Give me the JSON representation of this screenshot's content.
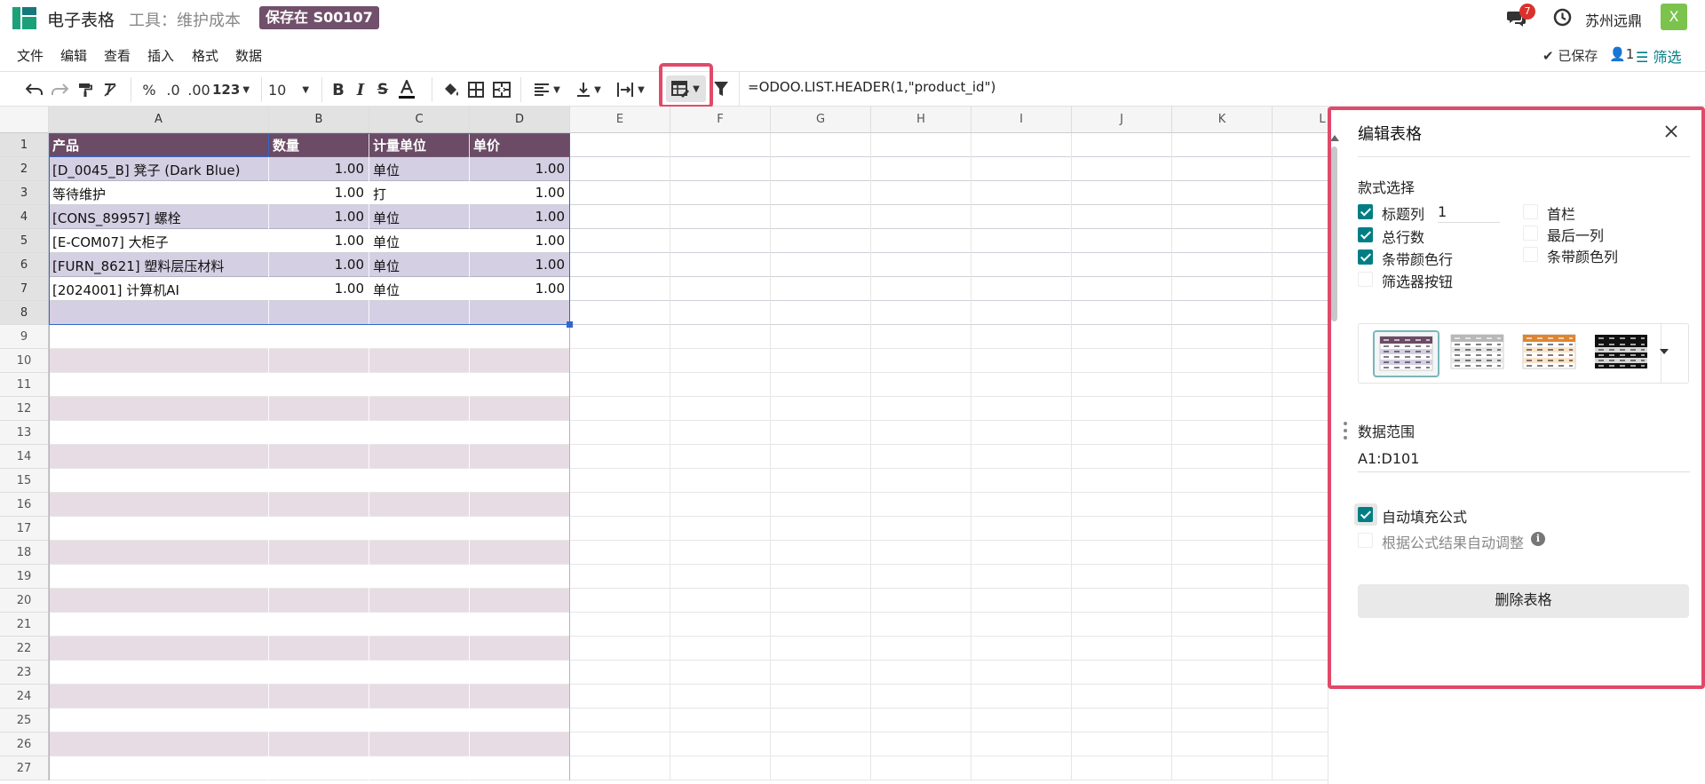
{
  "app": {
    "title": "电子表格",
    "tool_label": "工具：维护成本",
    "save_badge": "保存在 S00107"
  },
  "topbar": {
    "chat_count": "7",
    "company": "苏州远鼎",
    "avatar_letter": "X"
  },
  "menu": {
    "items": [
      "文件",
      "编辑",
      "查看",
      "插入",
      "格式",
      "数据"
    ],
    "saved": "已保存",
    "users": "1",
    "filter": "筛选"
  },
  "toolbar": {
    "percent": "%",
    "dec_less": ".0",
    "dec_more": ".00",
    "format": "123",
    "font_size": "10",
    "formula": "=ODOO.LIST.HEADER(1,\"product_id\")"
  },
  "grid": {
    "columns": [
      "A",
      "B",
      "C",
      "D",
      "E",
      "F",
      "G",
      "H",
      "I",
      "J",
      "K",
      "L"
    ],
    "rows": [
      "1",
      "2",
      "3",
      "4",
      "5",
      "6",
      "7",
      "8",
      "9",
      "10",
      "11",
      "12",
      "13",
      "14",
      "15",
      "16",
      "17",
      "18",
      "19",
      "20",
      "21",
      "22",
      "23",
      "24",
      "25",
      "26",
      "27"
    ],
    "header": [
      "产品",
      "数量",
      "计量单位",
      "单价"
    ],
    "data": [
      [
        "[D_0045_B] 凳子 (Dark Blue)",
        "1.00",
        "单位",
        "1.00"
      ],
      [
        "等待维护",
        "1.00",
        "打",
        "1.00"
      ],
      [
        "[CONS_89957] 螺栓",
        "1.00",
        "单位",
        "1.00"
      ],
      [
        "[E-COM07] 大柜子",
        "1.00",
        "单位",
        "1.00"
      ],
      [
        "[FURN_8621] 塑料层压材料",
        "1.00",
        "单位",
        "1.00"
      ],
      [
        "[2024001] 计算机AI",
        "1.00",
        "单位",
        "1.00"
      ]
    ]
  },
  "panel": {
    "title": "编辑表格",
    "style_section": "款式选择",
    "options_left": [
      {
        "label": "标题列",
        "checked": true
      },
      {
        "label": "总行数",
        "checked": true
      },
      {
        "label": "条带颜色行",
        "checked": true
      },
      {
        "label": "筛选器按钮",
        "checked": false
      }
    ],
    "header_count": "1",
    "options_right": [
      {
        "label": "首栏",
        "checked": false
      },
      {
        "label": "最后一列",
        "checked": false
      },
      {
        "label": "条带颜色列",
        "checked": false
      }
    ],
    "range_section": "数据范围",
    "range_value": "A1:D101",
    "autofill_label": "自动填充公式",
    "autoadjust_label": "根据公式结果自动调整",
    "delete_label": "删除表格"
  },
  "colors": {
    "accent": "#017e84",
    "table_header": "#6b4b65",
    "band_purple": "#d4cfe3",
    "band_pink": "#e8dce4",
    "highlight": "#e04a6a"
  }
}
